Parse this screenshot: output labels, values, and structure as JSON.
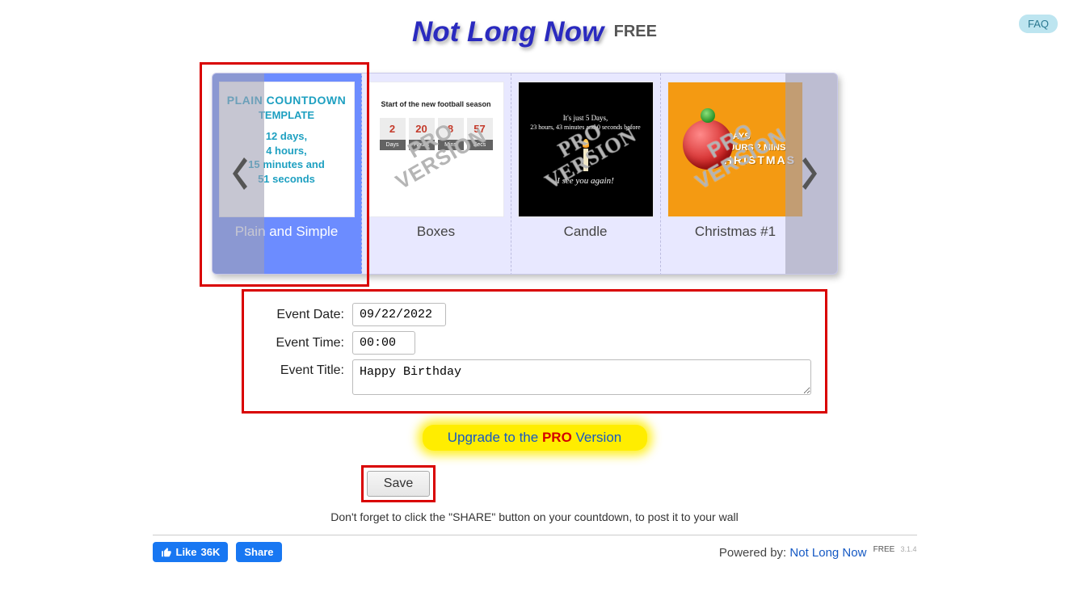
{
  "faq": "FAQ",
  "title": {
    "main": "Not Long Now",
    "badge": "FREE"
  },
  "carousel": {
    "items": [
      {
        "label": "Plain and Simple",
        "preview": {
          "head": "PLAIN COUNTDOWN",
          "sub": "TEMPLATE",
          "line1": "12 days,",
          "line2": "4 hours,",
          "line3": "15 minutes and",
          "line4": "51 seconds"
        }
      },
      {
        "label": "Boxes",
        "pro": true,
        "preview": {
          "title": "Start of the new football season",
          "nums": [
            "2",
            "20",
            "8",
            "57"
          ],
          "lbls": [
            "Days",
            "Hours",
            "Mins",
            "Secs"
          ]
        }
      },
      {
        "label": "Candle",
        "pro": true,
        "preview": {
          "l1": "It's just 5 Days,",
          "l2": "23 hours, 43 minutes and 0 seconds before",
          "l3": "I see you again!"
        }
      },
      {
        "label": "Christmas #1",
        "pro": true,
        "preview": {
          "l1": "84 DAYS",
          "l2": "8 HOURS 2 MINS",
          "big": "CHRISTMAS"
        }
      }
    ]
  },
  "pro_watermark": {
    "l1": "PRO",
    "l2": "VERSION"
  },
  "form": {
    "date": {
      "label": "Event Date:",
      "value": "09/22/2022"
    },
    "time": {
      "label": "Event Time:",
      "value": "00:00"
    },
    "title": {
      "label": "Event Title:",
      "value": "Happy Birthday"
    }
  },
  "promo": {
    "p1a": "Upgrade to the ",
    "p2": "PRO",
    "p1b": " Version"
  },
  "save": "Save",
  "reminder": "Don't forget to click the \"SHARE\" button on your countdown, to post it to your wall",
  "footer": {
    "like": "Like",
    "like_count": "36K",
    "share": "Share",
    "powered": "Powered by: ",
    "link": "Not Long Now",
    "link_badge": "FREE",
    "version": "3.1.4"
  }
}
